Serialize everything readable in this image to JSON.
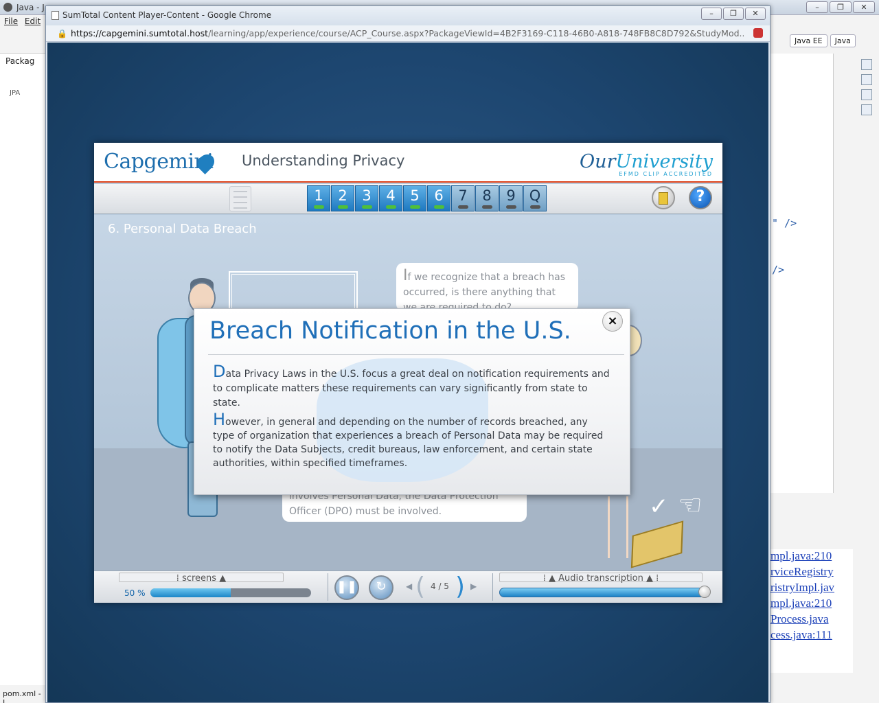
{
  "eclipse": {
    "title": "Java - JPA",
    "menu": [
      "File",
      "Edit"
    ],
    "panel_tab": "Packag",
    "tree_first": "JPA",
    "status": "pom.xml - J",
    "perspectives": [
      "Java EE",
      "Java"
    ],
    "code_snippets": [
      "\" />",
      "/>"
    ],
    "console_lines": [
      "mpl.java:210",
      "rviceRegistry",
      "ristryImpl.jav",
      "mpl.java:210",
      "Process.java",
      "cess.java:111"
    ]
  },
  "chrome": {
    "title": "SumTotal Content Player-Content - Google Chrome",
    "url_host": "https://capgemini.sumtotal.host",
    "url_rest": "/learning/app/experience/course/ACP_Course.aspx?PackageViewId=4B2F3169-C118-46B0-A818-748FB8C8D792&StudyMod..."
  },
  "player": {
    "brand": "Capgemini",
    "course_title": "Understanding Privacy",
    "partner_logo_a": "Our",
    "partner_logo_b": "University",
    "partner_tagline": "EFMD CLIP ACCREDITED",
    "chapters": [
      {
        "label": "1",
        "done": true
      },
      {
        "label": "2",
        "done": true
      },
      {
        "label": "3",
        "done": true
      },
      {
        "label": "4",
        "done": true
      },
      {
        "label": "5",
        "done": true
      },
      {
        "label": "6",
        "done": true
      },
      {
        "label": "7",
        "done": false
      },
      {
        "label": "8",
        "done": false
      },
      {
        "label": "9",
        "done": false
      },
      {
        "label": "Q",
        "done": false
      }
    ],
    "help_label": "?",
    "section_title": "6. Personal Data Breach",
    "question_cap": "I",
    "question_text": "f we recognize that a breach has occurred,  is there anything that we are required to do?",
    "answer_text": "involves Personal Data, the Data Protection Officer (DPO) must be involved.",
    "footer": {
      "screens_label": "screens",
      "progress_text": "50 %",
      "progress": 0.5,
      "page": "4 / 5",
      "audio_label": "Audio transcription"
    }
  },
  "modal": {
    "title": "Breach Notification in the U.S.",
    "close": "×",
    "p1_cap": "D",
    "p1_text": "ata Privacy Laws in the U.S. focus a great deal on notification requirements and to complicate matters these requirements can vary significantly from state to state.",
    "p2_cap": "H",
    "p2_text": "owever, in general and depending on the number of records breached, any type of organization that experiences a breach of Personal Data may be required to notify the Data Subjects, credit bureaus, law enforcement, and certain state authorities, within specified timeframes."
  }
}
